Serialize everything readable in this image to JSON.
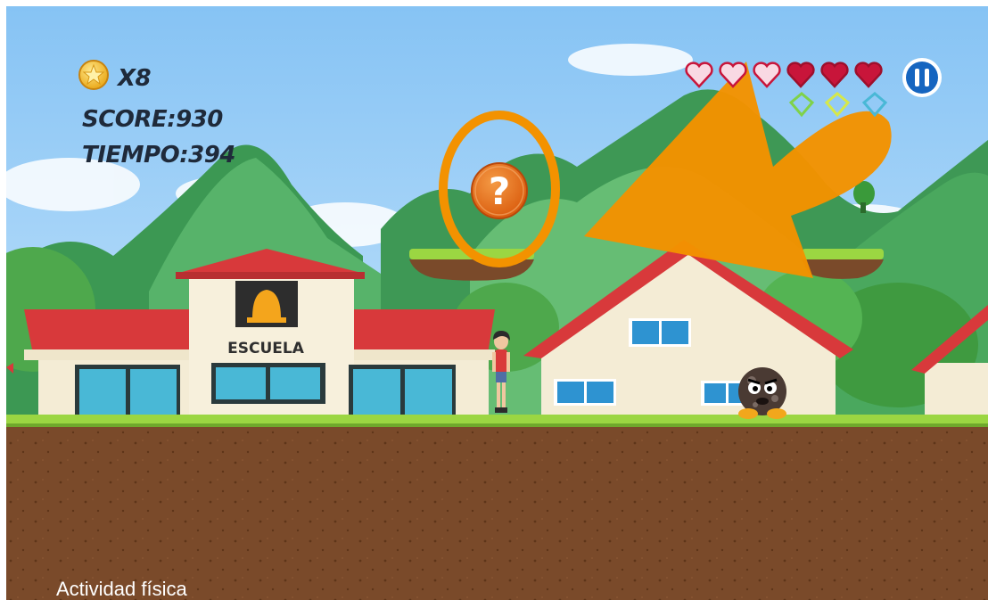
{
  "hud": {
    "coins_label": "X8",
    "score_label": "SCORE:930",
    "time_label": "TIEMPO:394",
    "hearts_total": 6,
    "hearts_lost": 3,
    "coin_icon": "star-coin-icon",
    "pause_icon": "pause-icon"
  },
  "world": {
    "school_sign": "ESCUELA",
    "question_block_glyph": "?"
  },
  "caption": "Actividad física",
  "colors": {
    "sky": "#8ec7f5",
    "hill_dark": "#3f9a57",
    "hill_light": "#6cc07a",
    "grass": "#9bd642",
    "dirt": "#7a4a2a",
    "roof_red": "#d8393b",
    "wall_cream": "#f4ecd5",
    "window": "#49b8d6",
    "arrow_orange": "#f39200",
    "heart_full": "#c8153a",
    "heart_empty": "#f9d9e3",
    "pause_blue": "#1565c0",
    "question_orange": "#e36a0f"
  }
}
